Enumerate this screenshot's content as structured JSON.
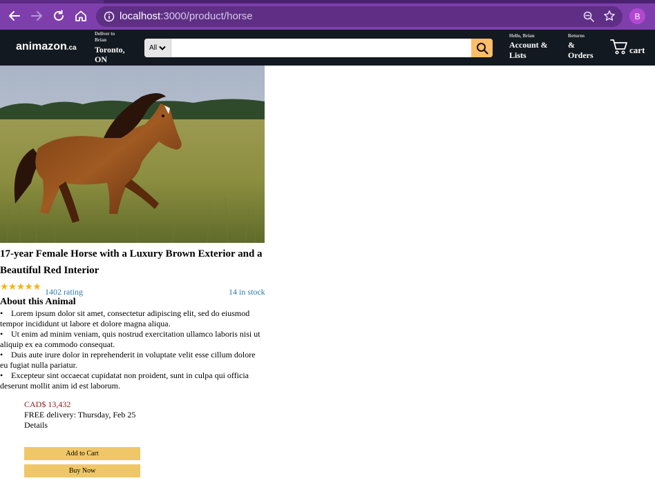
{
  "browser": {
    "url_host": "localhost",
    "url_path": ":3000/product/horse",
    "profile_initial": "B"
  },
  "header": {
    "logo": "animazon",
    "logo_suffix": ".ca",
    "deliver_small_1": "Deliver to",
    "deliver_small_2": "Brian",
    "deliver_location_1": "Toronto,",
    "deliver_location_2": "ON",
    "search_category": "All",
    "search_value": "",
    "account_greeting": "Hello, Brian",
    "account_label_1": "Account &",
    "account_label_2": "Lists",
    "returns_small": "Returns",
    "orders_label_1": "&",
    "orders_label_2": "Orders",
    "cart_label": "cart"
  },
  "product": {
    "title": "17-year Female Horse with a Luxury Brown Exterior and a Beautiful Red Interior",
    "rating_stars": 5,
    "rating_text": "1402 rating",
    "stock_text": "14 in stock",
    "about_heading": "About this Animal",
    "bullets": [
      "Lorem ipsum dolor sit amet, consectetur adipiscing elit, sed do eiusmod tempor incididunt ut labore et dolore magna aliqua.",
      "Ut enim ad minim veniam, quis nostrud exercitation ullamco laboris nisi ut aliquip ex ea commodo consequat.",
      "Duis aute irure dolor in reprehenderit in voluptate velit esse cillum dolore eu fugiat nulla pariatur.",
      "Excepteur sint occaecat cupidatat non proident, sunt in culpa qui officia deserunt mollit anim id est laborum."
    ],
    "price": "CAD$ 13,432",
    "delivery": "FREE delivery: Thursday, Feb 25",
    "details": "Details",
    "add_to_cart": "Add to Cart",
    "buy_now": "Buy Now"
  },
  "colors": {
    "browser_frame": "#7e3fad",
    "header_bg": "#131921",
    "search_button": "#febd69",
    "star": "#f3b21b",
    "link": "#2a7ab0",
    "price": "#8b1a1a",
    "buy_button": "#f0c768"
  }
}
